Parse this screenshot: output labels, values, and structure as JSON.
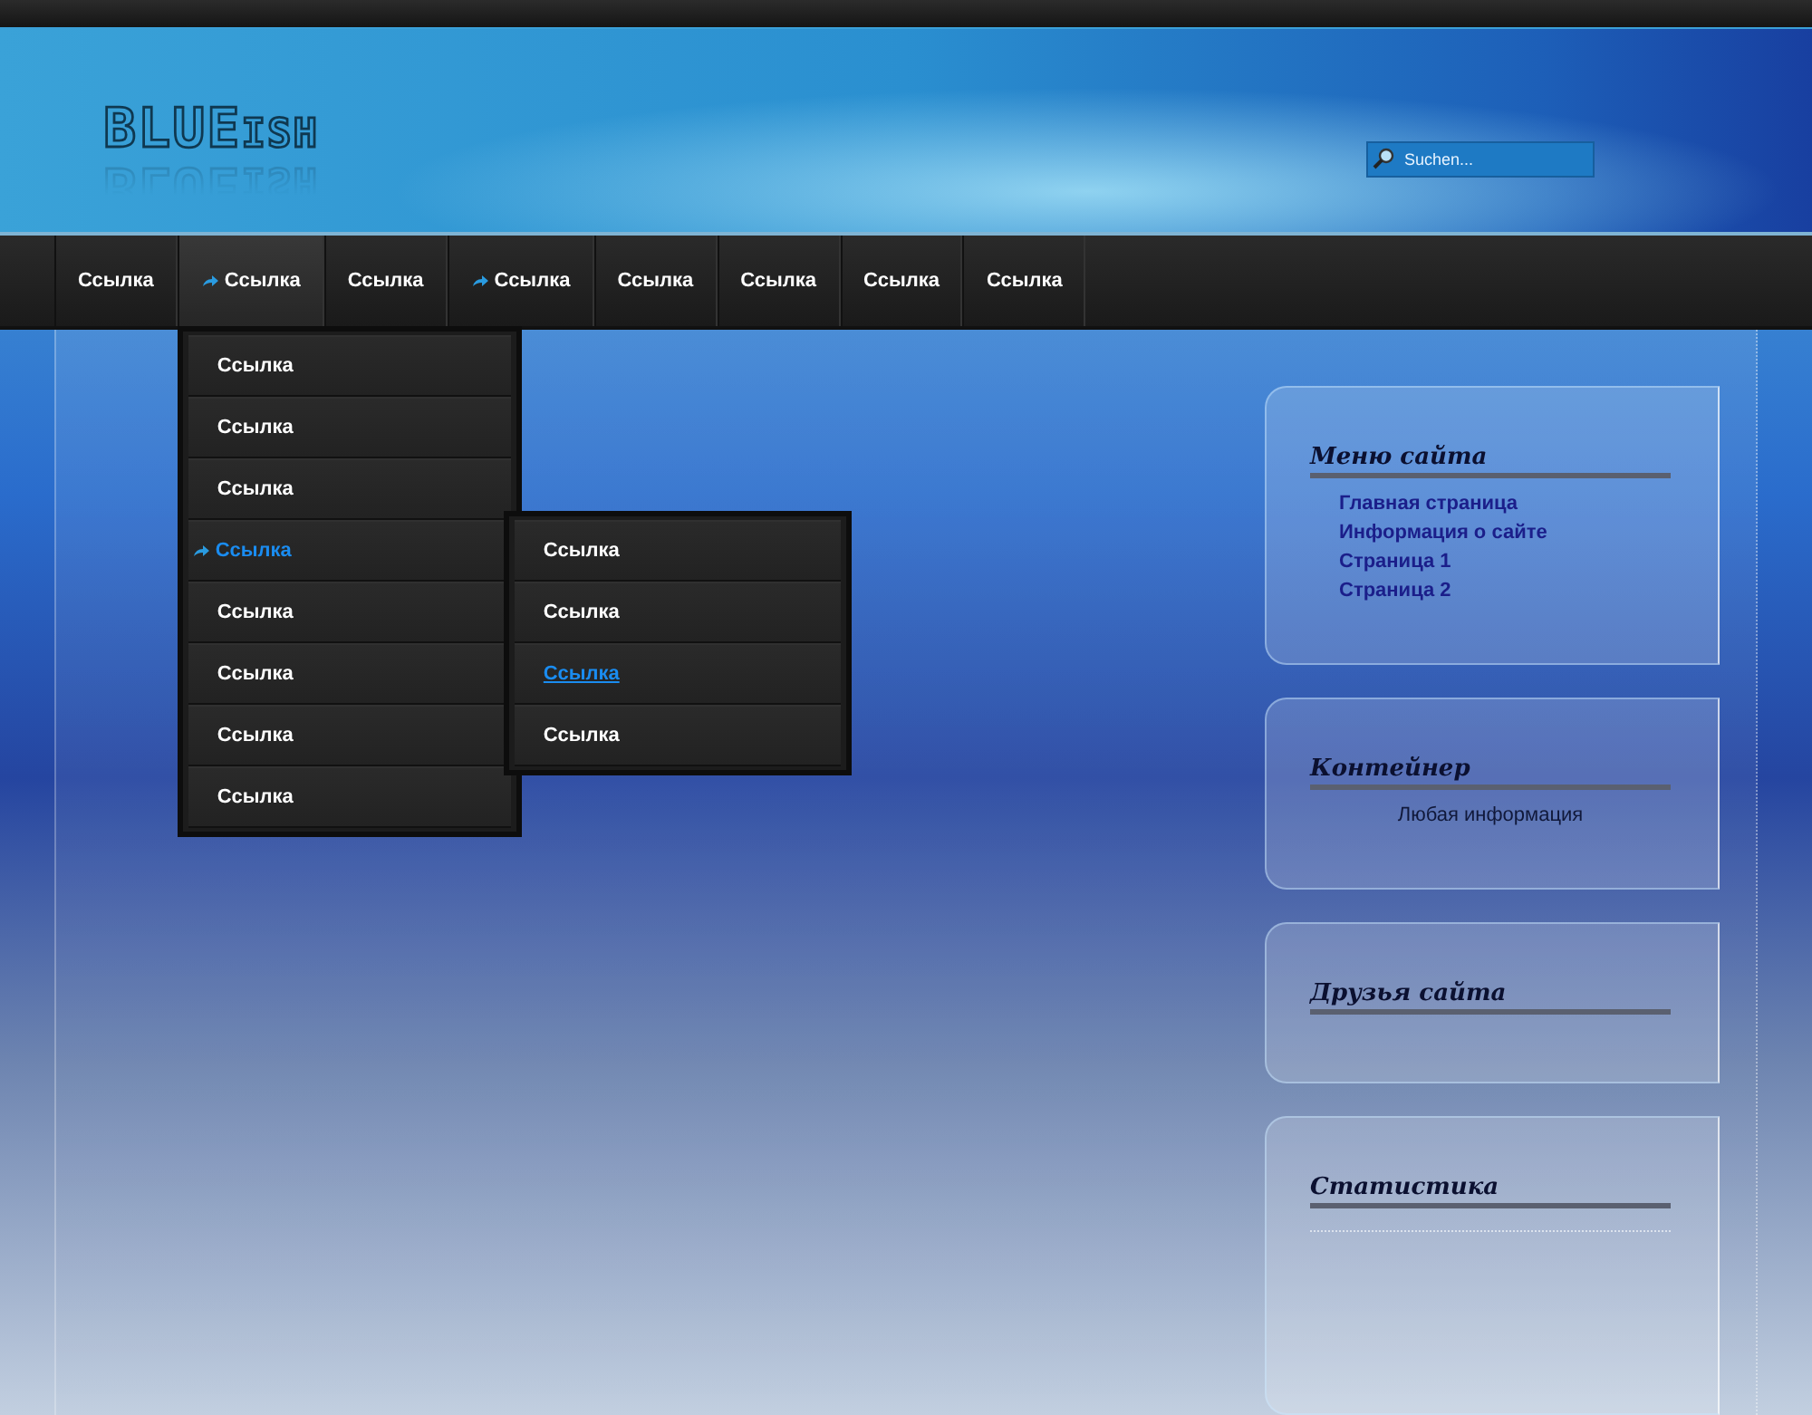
{
  "logo": {
    "main": "BLUE",
    "suffix": "ISH"
  },
  "search": {
    "placeholder": "Suchen..."
  },
  "nav": [
    {
      "label": "Ссылка",
      "has_submenu": false,
      "expanded": false
    },
    {
      "label": "Ссылка",
      "has_submenu": true,
      "expanded": true,
      "children": [
        {
          "label": "Ссылка",
          "selected": false,
          "has_submenu": false
        },
        {
          "label": "Ссылка",
          "selected": false,
          "has_submenu": false
        },
        {
          "label": "Ссылка",
          "selected": false,
          "has_submenu": false
        },
        {
          "label": "Ссылка",
          "selected": true,
          "has_submenu": true,
          "children": [
            {
              "label": "Ссылка",
              "selected": false
            },
            {
              "label": "Ссылка",
              "selected": false
            },
            {
              "label": "Ссылка",
              "selected": true
            },
            {
              "label": "Ссылка",
              "selected": false
            }
          ]
        },
        {
          "label": "Ссылка",
          "selected": false,
          "has_submenu": false
        },
        {
          "label": "Ссылка",
          "selected": false,
          "has_submenu": false
        },
        {
          "label": "Ссылка",
          "selected": false,
          "has_submenu": false
        },
        {
          "label": "Ссылка",
          "selected": false,
          "has_submenu": false
        }
      ]
    },
    {
      "label": "Ссылка",
      "has_submenu": false,
      "expanded": false
    },
    {
      "label": "Ссылка",
      "has_submenu": true,
      "expanded": false
    },
    {
      "label": "Ссылка",
      "has_submenu": false,
      "expanded": false
    },
    {
      "label": "Ссылка",
      "has_submenu": false,
      "expanded": false
    },
    {
      "label": "Ссылка",
      "has_submenu": false,
      "expanded": false
    },
    {
      "label": "Ссылка",
      "has_submenu": false,
      "expanded": false
    }
  ],
  "sidebar": [
    {
      "kind": "links",
      "title": "Меню сайта",
      "links": [
        "Главная страница",
        "Информация о сайте",
        "Страница 1",
        "Страница 2"
      ]
    },
    {
      "kind": "text",
      "title": "Контейнер",
      "text": "Любая информация"
    },
    {
      "kind": "empty",
      "title": "Друзья сайта"
    },
    {
      "kind": "counter",
      "title": "Статистика"
    }
  ]
}
